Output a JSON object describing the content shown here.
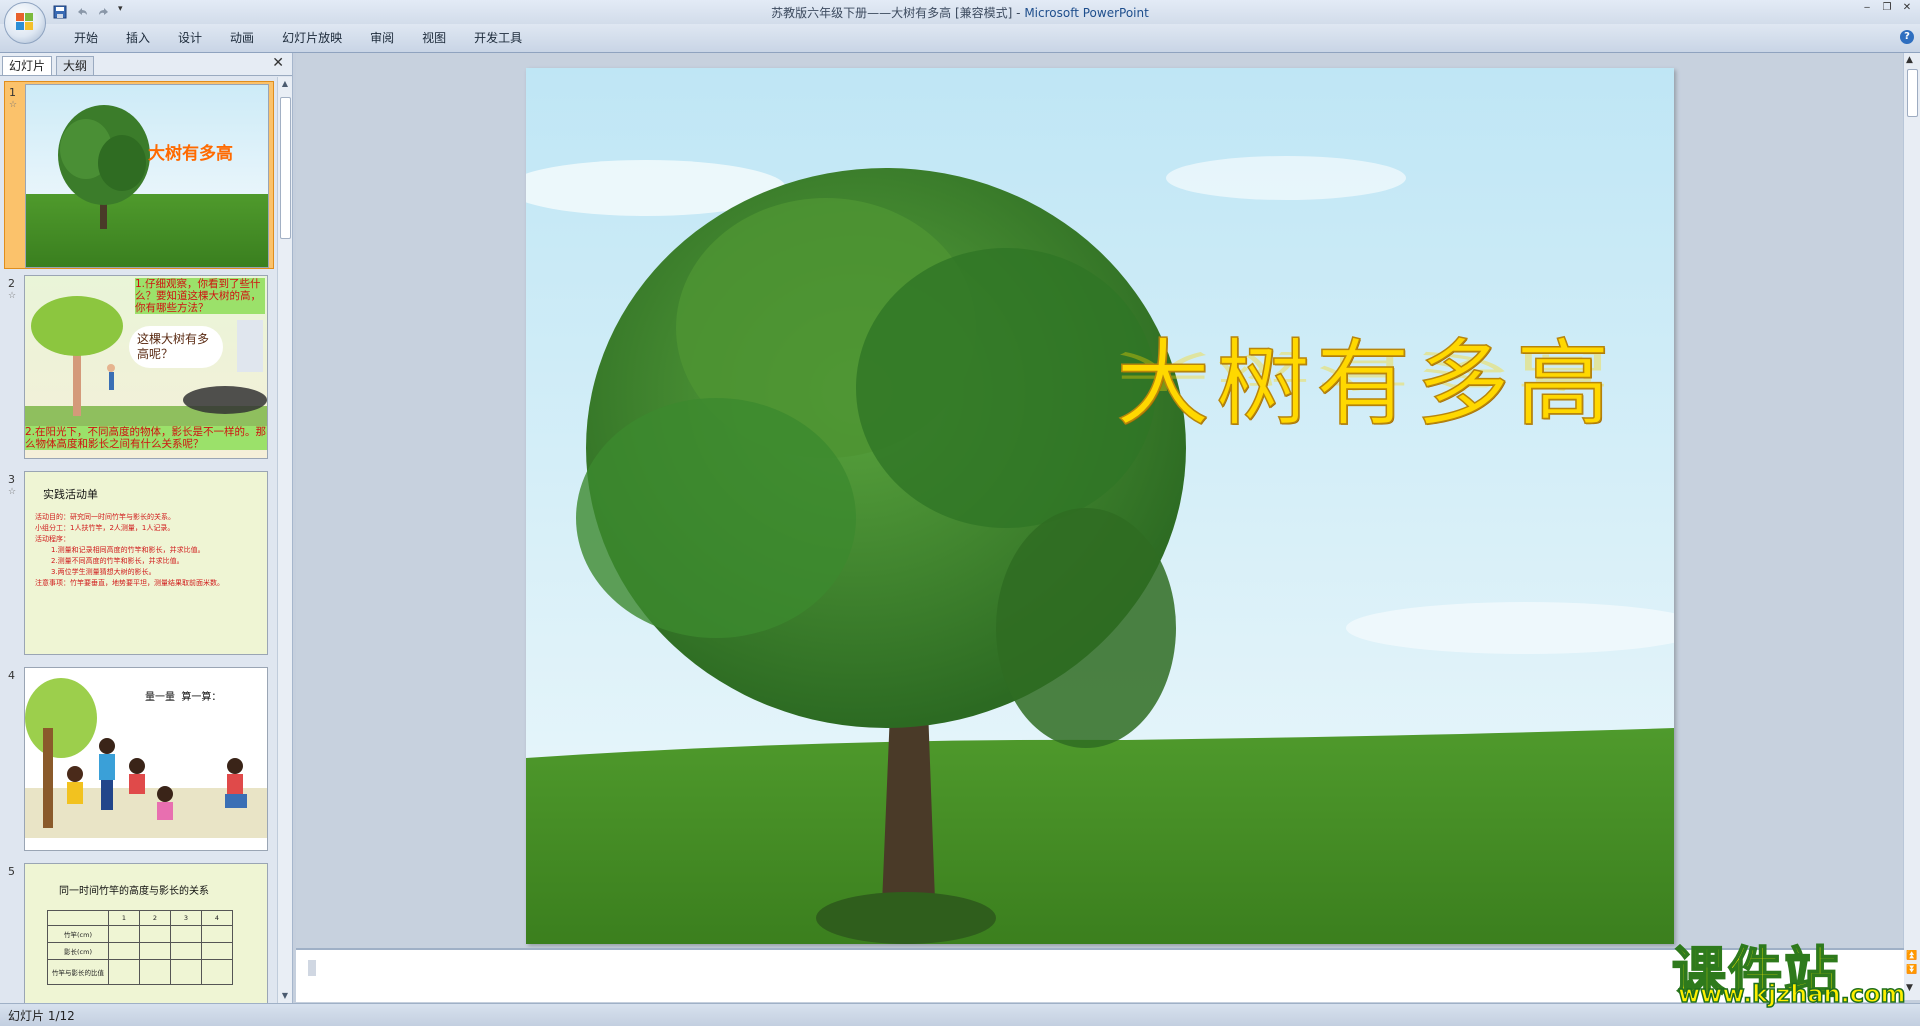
{
  "window": {
    "title_doc": "苏教版六年级下册——大树有多高 [兼容模式]",
    "title_sep": " - ",
    "title_app": "Microsoft PowerPoint"
  },
  "ribbon": {
    "tabs": [
      "开始",
      "插入",
      "设计",
      "动画",
      "幻灯片放映",
      "审阅",
      "视图",
      "开发工具"
    ]
  },
  "panel": {
    "tab_slides": "幻灯片",
    "tab_outline": "大纲",
    "close": "✕"
  },
  "thumbnails": [
    {
      "num": "1",
      "title": "大树有多高"
    },
    {
      "num": "2",
      "q1": "1.仔细观察，你看到了些什么？要知道这棵大树的高，你有哪些方法？",
      "bubble": "这棵大树有多高呢？",
      "q2": "2.在阳光下，不同高度的物体，影长是不一样的。那么物体高度和影长之间有什么关系呢？"
    },
    {
      "num": "3",
      "heading": "实践活动单",
      "lines": [
        "活动目的：研究同一时间竹竿与影长的关系。",
        "小组分工：1人扶竹竿，2人测量，1人记录。",
        "活动程序：",
        "1.测量和记录相同高度的竹竿和影长，并求比值。",
        "2.测量不同高度的竹竿和影长，并求比值。",
        "3.两位学生测量猜想大树的影长。",
        "注意事项：竹竿要垂直，地势要平坦，测量结果取前面米数。"
      ]
    },
    {
      "num": "4",
      "caption": "量一量  算一算："
    },
    {
      "num": "5",
      "heading": "同一时间竹竿的高度与影长的关系",
      "cols": [
        "",
        "1",
        "2",
        "3",
        "4"
      ],
      "rows": [
        "竹竿(cm)",
        "影长(cm)",
        "竹竿与影长的比值"
      ]
    }
  ],
  "slide": {
    "title": "大树有多高"
  },
  "status": {
    "slide_counter": "幻灯片 1/12"
  },
  "watermark": {
    "name": "课件站",
    "url": "www.kjzhan.com"
  },
  "colors": {
    "title_yellow": "#ffd800",
    "sky": "#bfe6f5",
    "grass": "#4e8f2a",
    "selected_thumb": "#fbc26b"
  }
}
